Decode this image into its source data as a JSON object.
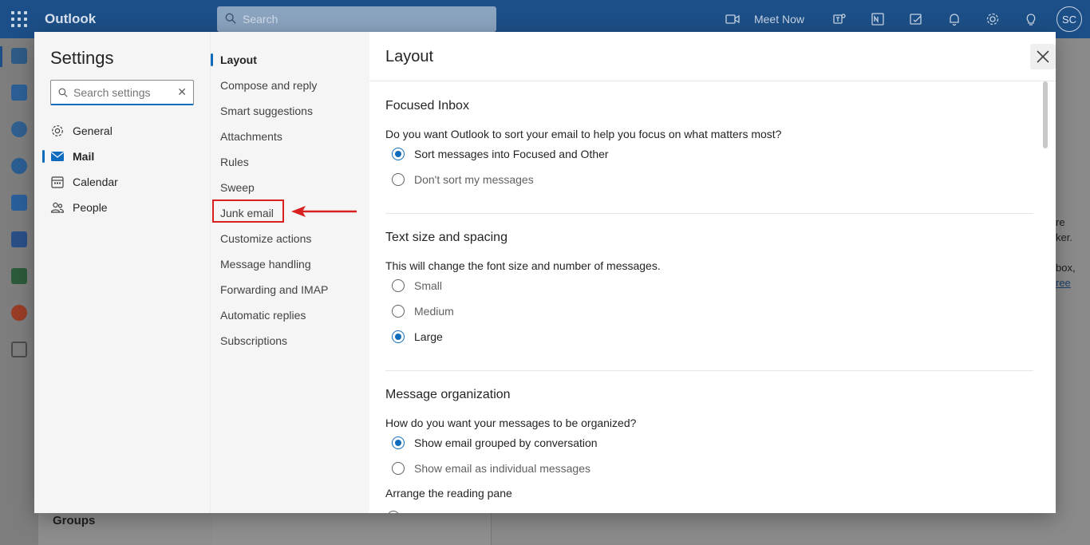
{
  "app": {
    "name": "Outlook"
  },
  "topbar": {
    "search_placeholder": "Search",
    "meet_now": "Meet Now",
    "avatar_initials": "SC"
  },
  "background": {
    "groups_label": "Groups",
    "right_fragments": [
      "re",
      "ker.",
      "box,",
      "ree"
    ]
  },
  "settings": {
    "title": "Settings",
    "search_placeholder": "Search settings",
    "nav": [
      {
        "label": "General",
        "icon": "gear-icon"
      },
      {
        "label": "Mail",
        "icon": "mail-icon"
      },
      {
        "label": "Calendar",
        "icon": "calendar-icon"
      },
      {
        "label": "People",
        "icon": "people-icon"
      }
    ],
    "mail_nav": [
      "Layout",
      "Compose and reply",
      "Smart suggestions",
      "Attachments",
      "Rules",
      "Sweep",
      "Junk email",
      "Customize actions",
      "Message handling",
      "Forwarding and IMAP",
      "Automatic replies",
      "Subscriptions"
    ],
    "active_mail_nav": "Layout",
    "highlighted_item": "Junk email"
  },
  "layout_pane": {
    "title": "Layout",
    "focused": {
      "heading": "Focused Inbox",
      "question": "Do you want Outlook to sort your email to help you focus on what matters most?",
      "options": [
        "Sort messages into Focused and Other",
        "Don't sort my messages"
      ],
      "selected": 0
    },
    "text_size": {
      "heading": "Text size and spacing",
      "question": "This will change the font size and number of messages.",
      "options": [
        "Small",
        "Medium",
        "Large"
      ],
      "selected": 2
    },
    "organization": {
      "heading": "Message organization",
      "question": "How do you want your messages to be organized?",
      "options": [
        "Show email grouped by conversation",
        "Show email as individual messages"
      ],
      "selected": 0,
      "next_label": "Arrange the reading pane"
    }
  },
  "colors": {
    "accent": "#0f6cbd",
    "topbar": "#1c4f87",
    "highlight_box": "#d92020"
  }
}
